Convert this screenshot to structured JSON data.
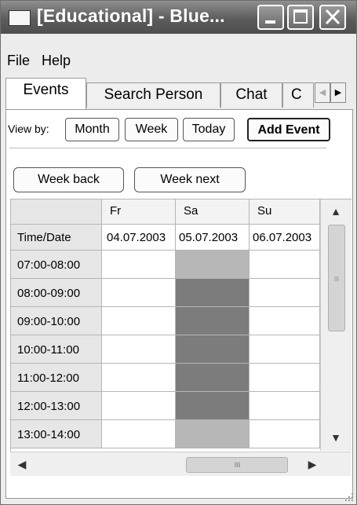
{
  "window": {
    "title": "[Educational] - Blue..."
  },
  "menu": {
    "items": [
      "File",
      "Help"
    ]
  },
  "tabs": {
    "items": [
      "Events",
      "Search Person",
      "Chat",
      "C"
    ]
  },
  "toolbar": {
    "view_by_label": "View by:",
    "month_label": "Month",
    "week_label": "Week",
    "today_label": "Today",
    "add_event_label": "Add Event"
  },
  "nav": {
    "week_back_label": "Week back",
    "week_next_label": "Week next"
  },
  "calendar": {
    "corner_label": "Time/Date",
    "days": [
      "Fr",
      "Sa",
      "Su"
    ],
    "dates": [
      "04.07.2003",
      "05.07.2003",
      "06.07.2003"
    ],
    "time_slots": [
      "07:00-08:00",
      "08:00-09:00",
      "09:00-10:00",
      "10:00-11:00",
      "11:00-12:00",
      "12:00-13:00",
      "13:00-14:00"
    ],
    "event_shading": {
      "Sa": [
        "light",
        "dark",
        "dark",
        "dark",
        "dark",
        "dark",
        "light"
      ]
    }
  },
  "scrollbars": {
    "horizontal_thumb_grip": "IIIII",
    "vertical_thumb_grip": "≡"
  },
  "colors": {
    "titlebar": "#5c5c5c",
    "event_dark": "#7c7c7c",
    "event_light": "#b7b7b7",
    "row_header": "#e6e6e6"
  },
  "icons": [
    "app-icon",
    "minimize-icon",
    "maximize-icon",
    "close-icon",
    "tab-scroll-left-icon",
    "tab-scroll-right-icon",
    "scroll-up-icon",
    "scroll-down-icon",
    "scroll-left-icon",
    "scroll-right-icon",
    "resize-grip-icon"
  ]
}
